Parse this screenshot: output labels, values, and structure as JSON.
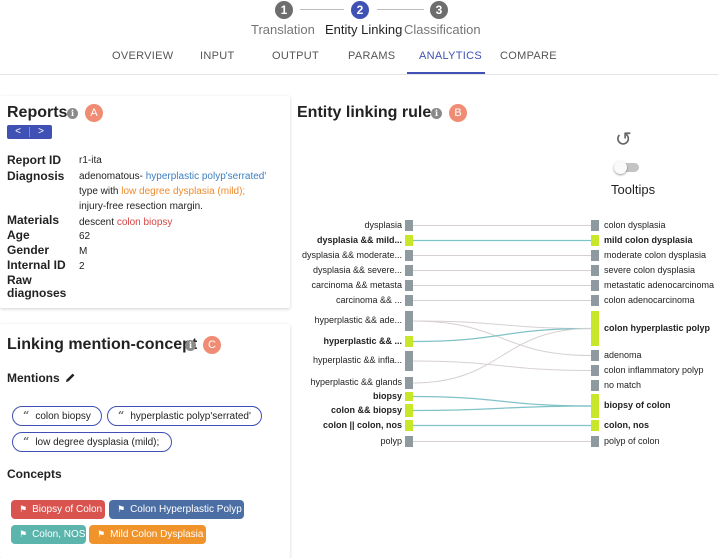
{
  "stepper": {
    "steps": [
      {
        "number": "1",
        "label": "Translation",
        "state": "done"
      },
      {
        "number": "2",
        "label": "Entity Linking",
        "state": "active"
      },
      {
        "number": "3",
        "label": "Classification",
        "state": "done"
      }
    ]
  },
  "tabs": [
    "OVERVIEW",
    "INPUT",
    "OUTPUT",
    "PARAMS",
    "ANALYTICS",
    "COMPARE"
  ],
  "active_tab": "ANALYTICS",
  "reports": {
    "title": "Reports",
    "badge": "A",
    "info": "i",
    "pager": {
      "prev": "<",
      "next": ">"
    },
    "fields": {
      "report_id": {
        "label": "Report ID",
        "value": "r1-ita"
      },
      "diagnosis": {
        "label": "Diagnosis",
        "line1_plain": "adenomatous- ",
        "line1_highlight": "hyperplastic polyp'serrated'",
        "line2_plain": "type with ",
        "line2_highlight": "low degree dysplasia (mild);",
        "line3_plain": "injury-free resection margin."
      },
      "materials": {
        "label": "Materials",
        "plain": "descent ",
        "highlight": "colon biopsy"
      },
      "age": {
        "label": "Age",
        "value": "62"
      },
      "gender": {
        "label": "Gender",
        "value": "M"
      },
      "internal_id": {
        "label": "Internal ID",
        "value": "2"
      },
      "raw_diagnoses": {
        "label_line1": "Raw",
        "label_line2": "diagnoses"
      }
    }
  },
  "linking": {
    "title": "Linking mention-concept",
    "badge": "C",
    "info": "i",
    "mentions_heading": "Mentions",
    "mentions_quote": "“",
    "mentions": [
      "colon biopsy",
      "hyperplastic polyp'serrated'",
      "low degree dysplasia (mild);"
    ],
    "concepts_heading": "Concepts",
    "concepts": [
      {
        "label": "Biopsy of Colon",
        "color": "#d9534f"
      },
      {
        "label": "Colon Hyperplastic Polyp",
        "color": "#4b6fa5"
      },
      {
        "label": "Colon, NOS",
        "color": "#5bb5ad"
      },
      {
        "label": "Mild Colon Dysplasia",
        "color": "#f0932b"
      }
    ]
  },
  "rules": {
    "title": "Entity linking rules",
    "badge": "B",
    "info": "i",
    "reset_icon": "↺",
    "tooltips_label": "Tooltips",
    "tooltips_enabled": false,
    "highlight_color": "#c8e62a",
    "node_color": "#8e9aa0",
    "link_highlight_color": "#7fc2c7",
    "link_color": "#d7d0d0",
    "left_nodes": [
      {
        "label": "dysplasia",
        "highlighted": false
      },
      {
        "label": "dysplasia && mild...",
        "highlighted": true
      },
      {
        "label": "dysplasia && moderate...",
        "highlighted": false
      },
      {
        "label": "dysplasia && severe...",
        "highlighted": false
      },
      {
        "label": "carcinoma && metasta",
        "highlighted": false
      },
      {
        "label": "carcinoma && ...",
        "highlighted": false
      },
      {
        "label": "hyperplastic && ade...",
        "highlighted": false
      },
      {
        "label": "hyperplastic && ...",
        "highlighted": true
      },
      {
        "label": "hyperplastic && infla...",
        "highlighted": false
      },
      {
        "label": "hyperplastic && glands",
        "highlighted": false
      },
      {
        "label": "biopsy",
        "highlighted": true
      },
      {
        "label": "colon && biopsy",
        "highlighted": true
      },
      {
        "label": "colon || colon, nos",
        "highlighted": true
      },
      {
        "label": "polyp",
        "highlighted": false
      }
    ],
    "right_nodes": [
      {
        "label": "colon dysplasia",
        "highlighted": false
      },
      {
        "label": "mild colon dysplasia",
        "highlighted": true
      },
      {
        "label": "moderate colon dysplasia",
        "highlighted": false
      },
      {
        "label": "severe colon dysplasia",
        "highlighted": false
      },
      {
        "label": "metastatic adenocarcinoma",
        "highlighted": false
      },
      {
        "label": "colon adenocarcinoma",
        "highlighted": false
      },
      {
        "label": "colon hyperplastic polyp",
        "highlighted": true
      },
      {
        "label": "adenoma",
        "highlighted": false
      },
      {
        "label": "colon inflammatory polyp",
        "highlighted": false
      },
      {
        "label": "no match",
        "highlighted": false
      },
      {
        "label": "biopsy of colon",
        "highlighted": true
      },
      {
        "label": "colon, nos",
        "highlighted": true
      },
      {
        "label": "polyp of colon",
        "highlighted": false
      }
    ],
    "links": [
      {
        "from": 0,
        "to": 0,
        "highlighted": false
      },
      {
        "from": 1,
        "to": 1,
        "highlighted": true
      },
      {
        "from": 2,
        "to": 2,
        "highlighted": false
      },
      {
        "from": 3,
        "to": 3,
        "highlighted": false
      },
      {
        "from": 4,
        "to": 4,
        "highlighted": false
      },
      {
        "from": 5,
        "to": 5,
        "highlighted": false
      },
      {
        "from": 6,
        "to": 6,
        "highlighted": false
      },
      {
        "from": 6,
        "to": 7,
        "highlighted": false
      },
      {
        "from": 7,
        "to": 6,
        "highlighted": true
      },
      {
        "from": 8,
        "to": 8,
        "highlighted": false
      },
      {
        "from": 9,
        "to": 6,
        "highlighted": false
      },
      {
        "from": 10,
        "to": 10,
        "highlighted": true
      },
      {
        "from": 11,
        "to": 10,
        "highlighted": true
      },
      {
        "from": 12,
        "to": 11,
        "highlighted": true
      },
      {
        "from": 13,
        "to": 12,
        "highlighted": false
      }
    ]
  }
}
